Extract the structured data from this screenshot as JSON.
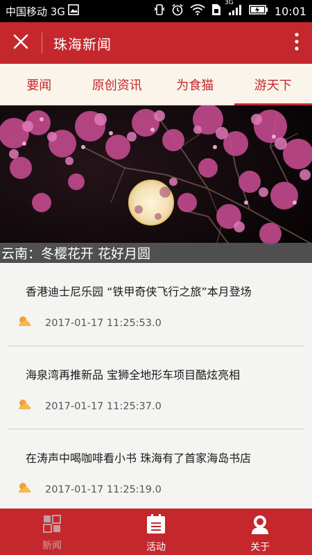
{
  "status_bar": {
    "carrier": "中国移动 3G",
    "time": "10:01",
    "signal_label": "3G",
    "icons": [
      "image-icon",
      "vibrate-icon",
      "alarm-icon",
      "wifi-icon",
      "sim-icon",
      "signal-icon",
      "battery-icon"
    ]
  },
  "app_bar": {
    "title": "珠海新闻",
    "close_icon": "close-icon",
    "more_icon": "more-vertical-icon"
  },
  "tabs": [
    {
      "label": "要闻",
      "active": false
    },
    {
      "label": "原创资讯",
      "active": false
    },
    {
      "label": "为食猫",
      "active": false
    },
    {
      "label": "游天下",
      "active": true
    }
  ],
  "banner": {
    "caption": "云南：冬樱花开 花好月圆"
  },
  "news": [
    {
      "title": "香港迪士尼乐园 “铁甲奇侠飞行之旅”本月登场",
      "date": "2017-01-17 11:25:53.0"
    },
    {
      "title": "海泉湾再推新品 宝狮全地形车项目酷炫亮相",
      "date": "2017-01-17 11:25:37.0"
    },
    {
      "title": "在涛声中喝咖啡看小书 珠海有了首家海岛书店",
      "date": "2017-01-17 11:25:19.0"
    }
  ],
  "bottom_nav": [
    {
      "label": "新闻",
      "icon": "grid-icon",
      "active": true
    },
    {
      "label": "活动",
      "icon": "calendar-icon",
      "active": false
    },
    {
      "label": "关于",
      "icon": "person-icon",
      "active": false
    }
  ],
  "colors": {
    "brand_red": "#c4282d",
    "tab_background": "#fbf4ea",
    "page_background": "#f4f4f2",
    "news_icon_orange": "#f2a03a"
  }
}
